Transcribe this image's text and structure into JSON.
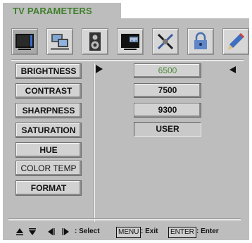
{
  "header": {
    "title": "TV PARAMETERS"
  },
  "icons": [
    {
      "name": "tv-screen-icon",
      "selected": true
    },
    {
      "name": "pc-icon",
      "selected": false
    },
    {
      "name": "speaker-icon",
      "selected": false
    },
    {
      "name": "pip-icon",
      "selected": false,
      "label": "PIP"
    },
    {
      "name": "tools-icon",
      "selected": false
    },
    {
      "name": "lock-icon",
      "selected": false
    },
    {
      "name": "pencil-icon",
      "selected": false
    }
  ],
  "menu": {
    "items": [
      {
        "label": "BRIGHTNESS"
      },
      {
        "label": "CONTRAST"
      },
      {
        "label": "SHARPNESS"
      },
      {
        "label": "SATURATION"
      },
      {
        "label": "HUE"
      },
      {
        "label": "COLOR TEMP"
      },
      {
        "label": "FORMAT"
      }
    ],
    "selected_label": "COLOR TEMP"
  },
  "options": [
    {
      "label": "6500",
      "current": true
    },
    {
      "label": "7500"
    },
    {
      "label": "9300"
    },
    {
      "label": "USER"
    }
  ],
  "footer": {
    "select_text": ": Select",
    "menu_key": "MENU",
    "exit_text": ": Exit",
    "enter_key": "ENTER",
    "enter_text": ": Enter"
  },
  "colors": {
    "panel": "#bdbdbd",
    "title": "#3f7f2a",
    "highlight_value": "#4f8a3c"
  }
}
